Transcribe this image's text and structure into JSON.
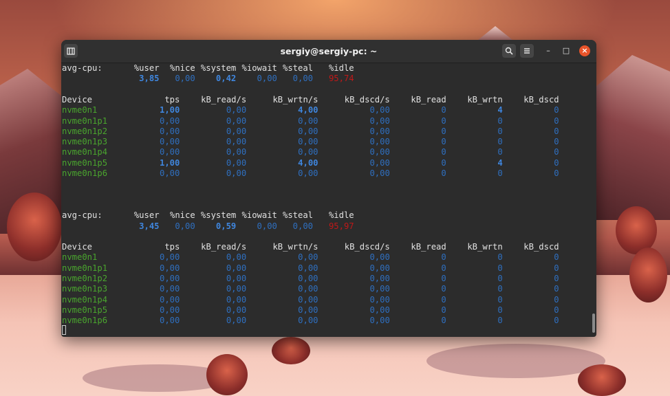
{
  "window": {
    "title": "sergiy@sergiy-pc: ~",
    "newtab_icon": "new-tab-icon",
    "search_icon": "search-icon",
    "menu_icon": "hamburger-menu-icon",
    "minimize_label": "–",
    "maximize_label": "□",
    "close_label": "×"
  },
  "cpu_header": {
    "label": "avg-cpu:",
    "cols": [
      "%user",
      "%nice",
      "%system",
      "%iowait",
      "%steal",
      "%idle"
    ]
  },
  "device_header": [
    "Device",
    "tps",
    "kB_read/s",
    "kB_wrtn/s",
    "kB_dscd/s",
    "kB_read",
    "kB_wrtn",
    "kB_dscd"
  ],
  "reports": [
    {
      "cpu": [
        "3,85",
        "0,00",
        "0,42",
        "0,00",
        "0,00",
        "95,74"
      ],
      "devices": [
        {
          "name": "nvme0n1",
          "vals": [
            "1,00",
            "0,00",
            "4,00",
            "0,00",
            "0",
            "4",
            "0"
          ]
        },
        {
          "name": "nvme0n1p1",
          "vals": [
            "0,00",
            "0,00",
            "0,00",
            "0,00",
            "0",
            "0",
            "0"
          ]
        },
        {
          "name": "nvme0n1p2",
          "vals": [
            "0,00",
            "0,00",
            "0,00",
            "0,00",
            "0",
            "0",
            "0"
          ]
        },
        {
          "name": "nvme0n1p3",
          "vals": [
            "0,00",
            "0,00",
            "0,00",
            "0,00",
            "0",
            "0",
            "0"
          ]
        },
        {
          "name": "nvme0n1p4",
          "vals": [
            "0,00",
            "0,00",
            "0,00",
            "0,00",
            "0",
            "0",
            "0"
          ]
        },
        {
          "name": "nvme0n1p5",
          "vals": [
            "1,00",
            "0,00",
            "4,00",
            "0,00",
            "0",
            "4",
            "0"
          ]
        },
        {
          "name": "nvme0n1p6",
          "vals": [
            "0,00",
            "0,00",
            "0,00",
            "0,00",
            "0",
            "0",
            "0"
          ]
        }
      ]
    },
    {
      "cpu": [
        "3,45",
        "0,00",
        "0,59",
        "0,00",
        "0,00",
        "95,97"
      ],
      "devices": [
        {
          "name": "nvme0n1",
          "vals": [
            "0,00",
            "0,00",
            "0,00",
            "0,00",
            "0",
            "0",
            "0"
          ]
        },
        {
          "name": "nvme0n1p1",
          "vals": [
            "0,00",
            "0,00",
            "0,00",
            "0,00",
            "0",
            "0",
            "0"
          ]
        },
        {
          "name": "nvme0n1p2",
          "vals": [
            "0,00",
            "0,00",
            "0,00",
            "0,00",
            "0",
            "0",
            "0"
          ]
        },
        {
          "name": "nvme0n1p3",
          "vals": [
            "0,00",
            "0,00",
            "0,00",
            "0,00",
            "0",
            "0",
            "0"
          ]
        },
        {
          "name": "nvme0n1p4",
          "vals": [
            "0,00",
            "0,00",
            "0,00",
            "0,00",
            "0",
            "0",
            "0"
          ]
        },
        {
          "name": "nvme0n1p5",
          "vals": [
            "0,00",
            "0,00",
            "0,00",
            "0,00",
            "0",
            "0",
            "0"
          ]
        },
        {
          "name": "nvme0n1p6",
          "vals": [
            "0,00",
            "0,00",
            "0,00",
            "0,00",
            "0",
            "0",
            "0"
          ]
        }
      ]
    }
  ],
  "colors": {
    "device": "#4aa52e",
    "value": "#2f6fbf",
    "value_highlight": "#3f86de",
    "idle": "#c01818",
    "close_button": "#e9542a"
  }
}
